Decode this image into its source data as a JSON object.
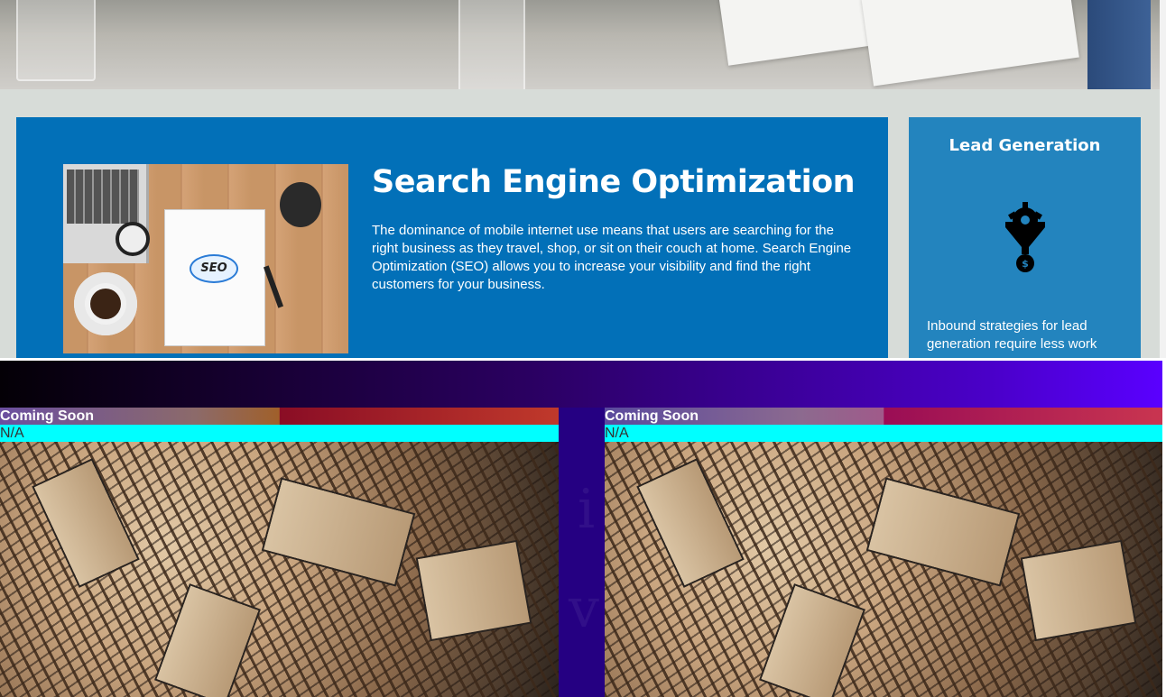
{
  "seo": {
    "title": "Search Engine Optimization",
    "body": "The dominance of mobile internet use means that users are searching for the right business as they travel, shop, or sit on their couch at home. Search Engine Optimization (SEO) allows you to increase your visibility and find the right customers for your business.",
    "image_labels": {
      "seo": "SEO"
    }
  },
  "lead": {
    "title": "Lead Generation",
    "icon": "gear-funnel-dollar-icon",
    "body": "Inbound strategies for lead generation require less work"
  },
  "items": [
    {
      "title": "Coming Soon",
      "status": "N/A"
    },
    {
      "title": "Coming Soon",
      "status": "N/A"
    }
  ]
}
